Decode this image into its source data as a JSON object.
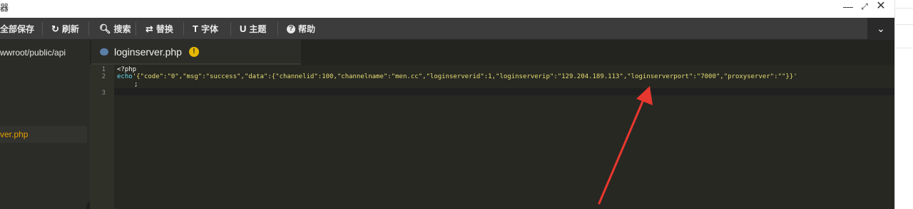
{
  "window": {
    "title": "器",
    "minimize_glyph": "—",
    "maximize_glyph": "⤢",
    "close_glyph": "✕"
  },
  "toolbar": {
    "items": [
      {
        "label": "全部保存",
        "icon": ""
      },
      {
        "label": "刷新",
        "icon": "refresh-icon"
      },
      {
        "label": "搜索",
        "icon": "search-icon"
      },
      {
        "label": "替换",
        "icon": "replace-icon"
      },
      {
        "label": "字体",
        "icon": "font-icon"
      },
      {
        "label": "主题",
        "icon": "magnet-icon"
      },
      {
        "label": "帮助",
        "icon": "help-icon"
      }
    ],
    "collapse_glyph": "⌄"
  },
  "sidebar": {
    "path": "wwroot/public/api",
    "file": "ver.php"
  },
  "tab": {
    "name": "loginserver.php",
    "warning_glyph": "!"
  },
  "editor": {
    "line_numbers": [
      "1",
      "2",
      "3"
    ],
    "line1": "<?php",
    "line2_keyword": "echo",
    "line2_string": "'{\"code\":\"0\",\"msg\":\"success\",\"data\":{\"channelid\":100,\"channelname\":\"men.cc\",\"loginserverid\":1,\"loginserverip\":\"129.204.189.113\",\"loginserverport\":\"7000\",\"proxyserver\":\"\"}}'",
    "line2_cont": ";"
  },
  "colors": {
    "toolbar_bg": "#3c3c3c",
    "editor_bg": "#272822",
    "annotation_arrow": "#e8372f",
    "active_file": "#e6a100"
  }
}
